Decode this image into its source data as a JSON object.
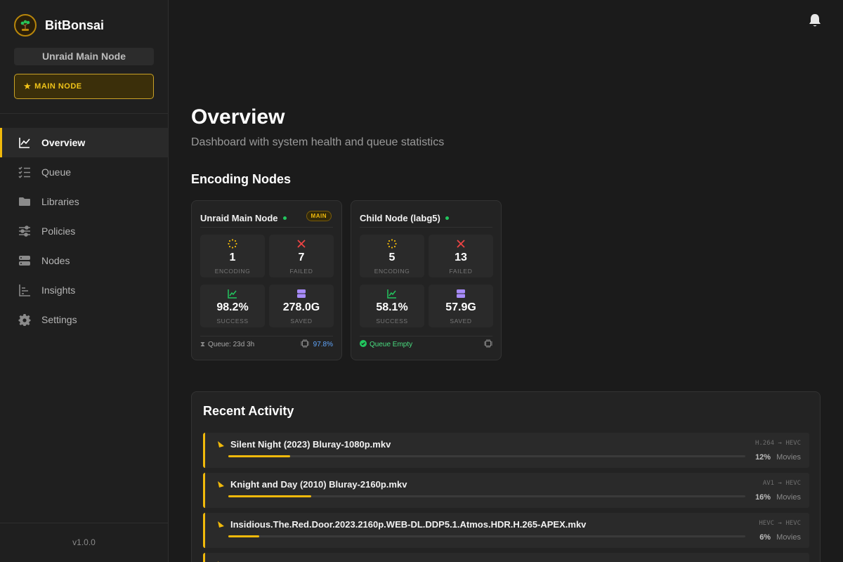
{
  "app": {
    "name": "BitBonsai",
    "version": "v1.0.0"
  },
  "sidebar": {
    "node_selector": "Unraid Main Node",
    "main_node_badge": "MAIN NODE",
    "items": [
      {
        "label": "Overview",
        "icon": "chart-line-icon",
        "active": true
      },
      {
        "label": "Queue",
        "icon": "list-check-icon",
        "active": false
      },
      {
        "label": "Libraries",
        "icon": "folder-icon",
        "active": false
      },
      {
        "label": "Policies",
        "icon": "sliders-icon",
        "active": false
      },
      {
        "label": "Nodes",
        "icon": "server-icon",
        "active": false
      },
      {
        "label": "Insights",
        "icon": "bar-chart-icon",
        "active": false
      },
      {
        "label": "Settings",
        "icon": "gear-icon",
        "active": false
      }
    ]
  },
  "header": {
    "notifications_icon": "bell-icon"
  },
  "page": {
    "title": "Overview",
    "subtitle": "Dashboard with system health and queue statistics",
    "nodes_section_title": "Encoding Nodes"
  },
  "nodes": [
    {
      "name": "Unraid Main Node",
      "tag": "MAIN",
      "stats": [
        {
          "value": "1",
          "label": "ENCODING",
          "icon": "spinner-icon"
        },
        {
          "value": "7",
          "label": "FAILED",
          "icon": "x-icon"
        },
        {
          "value": "98.2%",
          "label": "SUCCESS",
          "icon": "trend-icon"
        },
        {
          "value": "278.0G",
          "label": "SAVED",
          "icon": "storage-icon"
        }
      ],
      "footer_left": "Queue: 23d 3h",
      "footer_right": "97.8%"
    },
    {
      "name": "Child Node (labg5)",
      "tag": "",
      "stats": [
        {
          "value": "5",
          "label": "ENCODING",
          "icon": "spinner-icon"
        },
        {
          "value": "13",
          "label": "FAILED",
          "icon": "x-icon"
        },
        {
          "value": "58.1%",
          "label": "SUCCESS",
          "icon": "trend-icon"
        },
        {
          "value": "57.9G",
          "label": "SAVED",
          "icon": "storage-icon"
        }
      ],
      "footer_left": "Queue Empty",
      "footer_right": ""
    }
  ],
  "activity": {
    "title": "Recent Activity",
    "jobs": [
      {
        "name": "Silent Night (2023) Bluray-1080p.mkv",
        "codec": "H.264 → HEVC",
        "progress": "12%",
        "progress_value": 12,
        "library": "Movies"
      },
      {
        "name": "Knight and Day (2010) Bluray-2160p.mkv",
        "codec": "AV1 → HEVC",
        "progress": "16%",
        "progress_value": 16,
        "library": "Movies"
      },
      {
        "name": "Insidious.The.Red.Door.2023.2160p.WEB-DL.DDP5.1.Atmos.HDR.H.265-APEX.mkv",
        "codec": "HEVC → HEVC",
        "progress": "6%",
        "progress_value": 6,
        "library": "Movies"
      }
    ]
  },
  "colors": {
    "accent": "#f0b90b",
    "success": "#22c55e",
    "failed": "#ef4444",
    "saved": "#a78bfa",
    "info": "#60a5fa"
  }
}
